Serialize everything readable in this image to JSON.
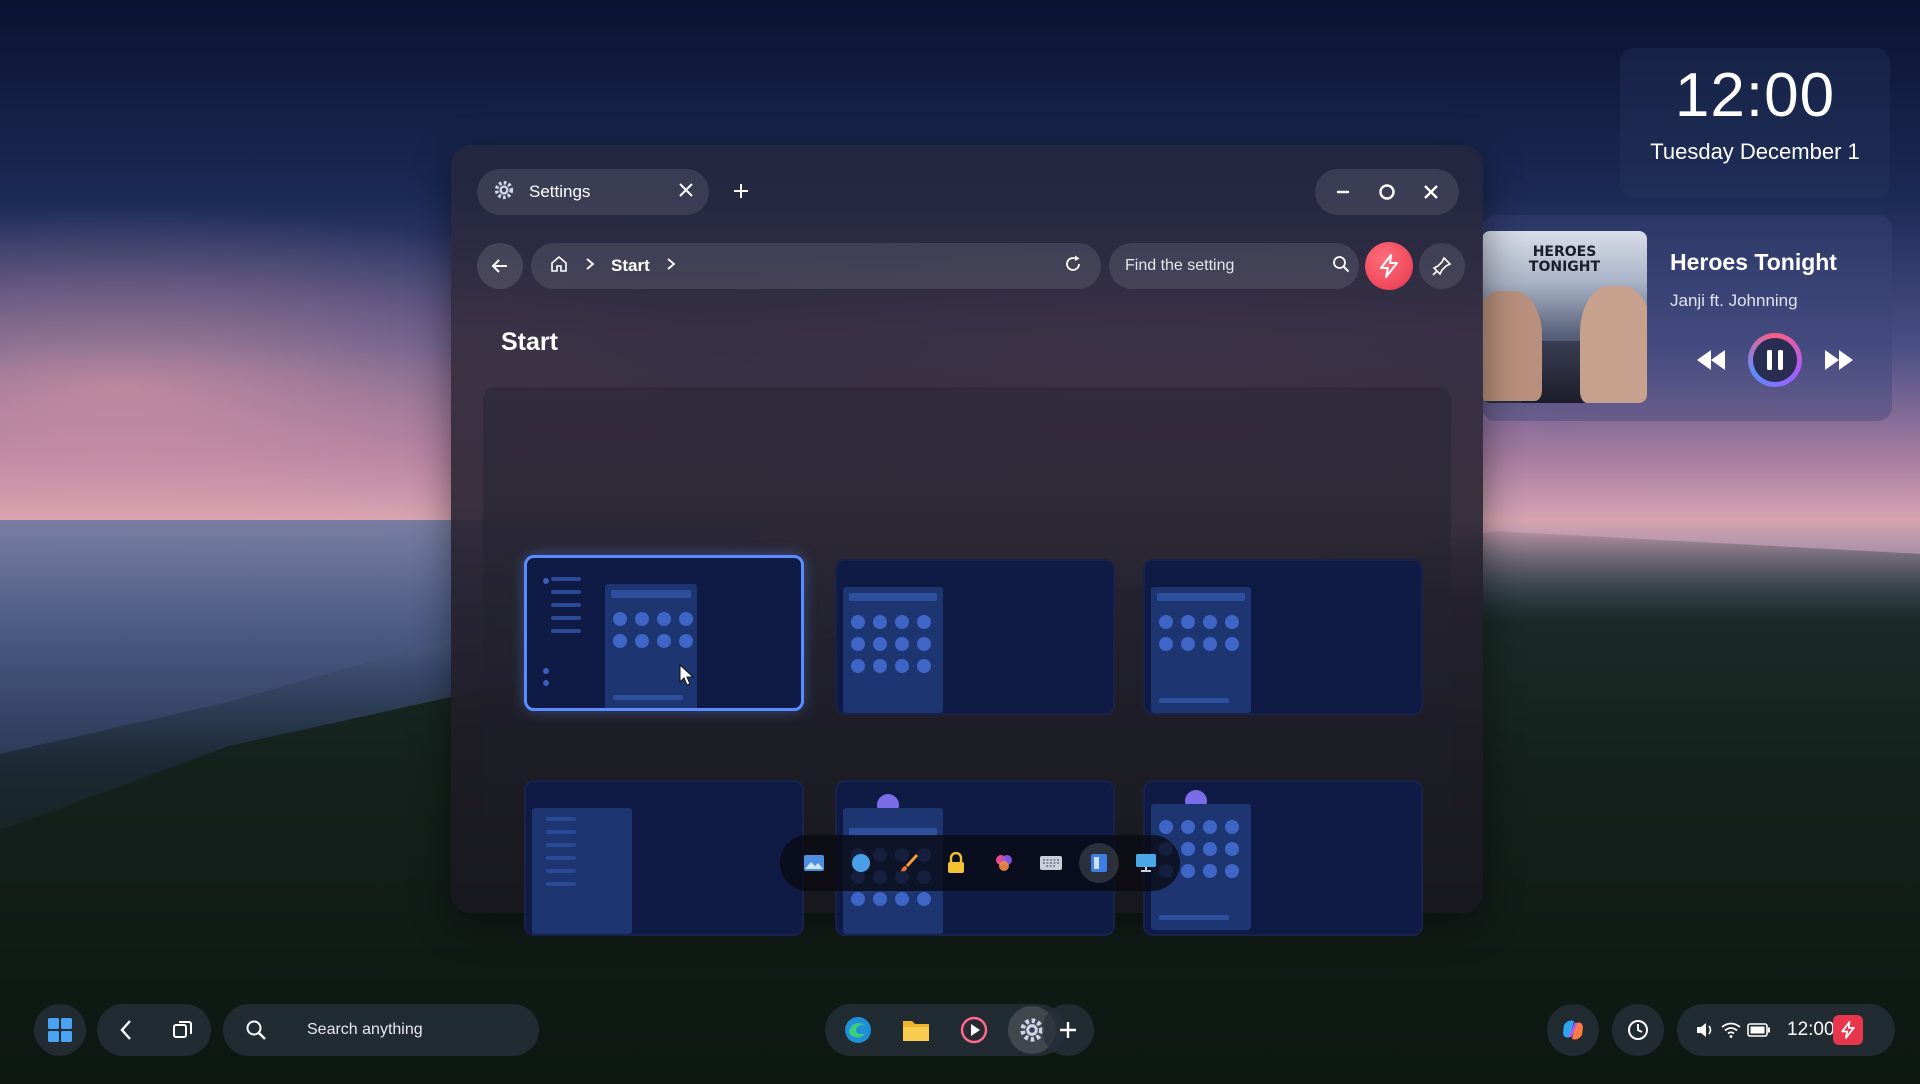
{
  "clock": {
    "time": "12:00",
    "date": "Tuesday December 1"
  },
  "media": {
    "album_text_line1": "HEROES",
    "album_text_line2": "TONIGHT",
    "title": "Heroes Tonight",
    "artist": "Janji ft. Johnning",
    "icons": {
      "previous": "rewind-icon",
      "pause": "pause-icon",
      "next": "fast-forward-icon"
    }
  },
  "window": {
    "tab_label": "Settings",
    "breadcrumb_current": "Start",
    "search_placeholder": "Find the setting",
    "page_title": "Start",
    "layouts": [
      {
        "id": "layout-1",
        "selected": true
      },
      {
        "id": "layout-2",
        "selected": false
      },
      {
        "id": "layout-3",
        "selected": false
      },
      {
        "id": "layout-4",
        "selected": false
      },
      {
        "id": "layout-5",
        "selected": false
      },
      {
        "id": "layout-6",
        "selected": false
      }
    ],
    "dock_icons": [
      "wallpaper-icon",
      "theme-icon",
      "brush-icon",
      "lock-icon",
      "colors-icon",
      "keyboard-icon",
      "start-layout-icon",
      "display-icon"
    ]
  },
  "taskbar": {
    "search_placeholder": "Search anything",
    "tray_time": "12:00",
    "colors": {
      "accent": "#5b8cff",
      "bolt": "#e8364d"
    }
  }
}
